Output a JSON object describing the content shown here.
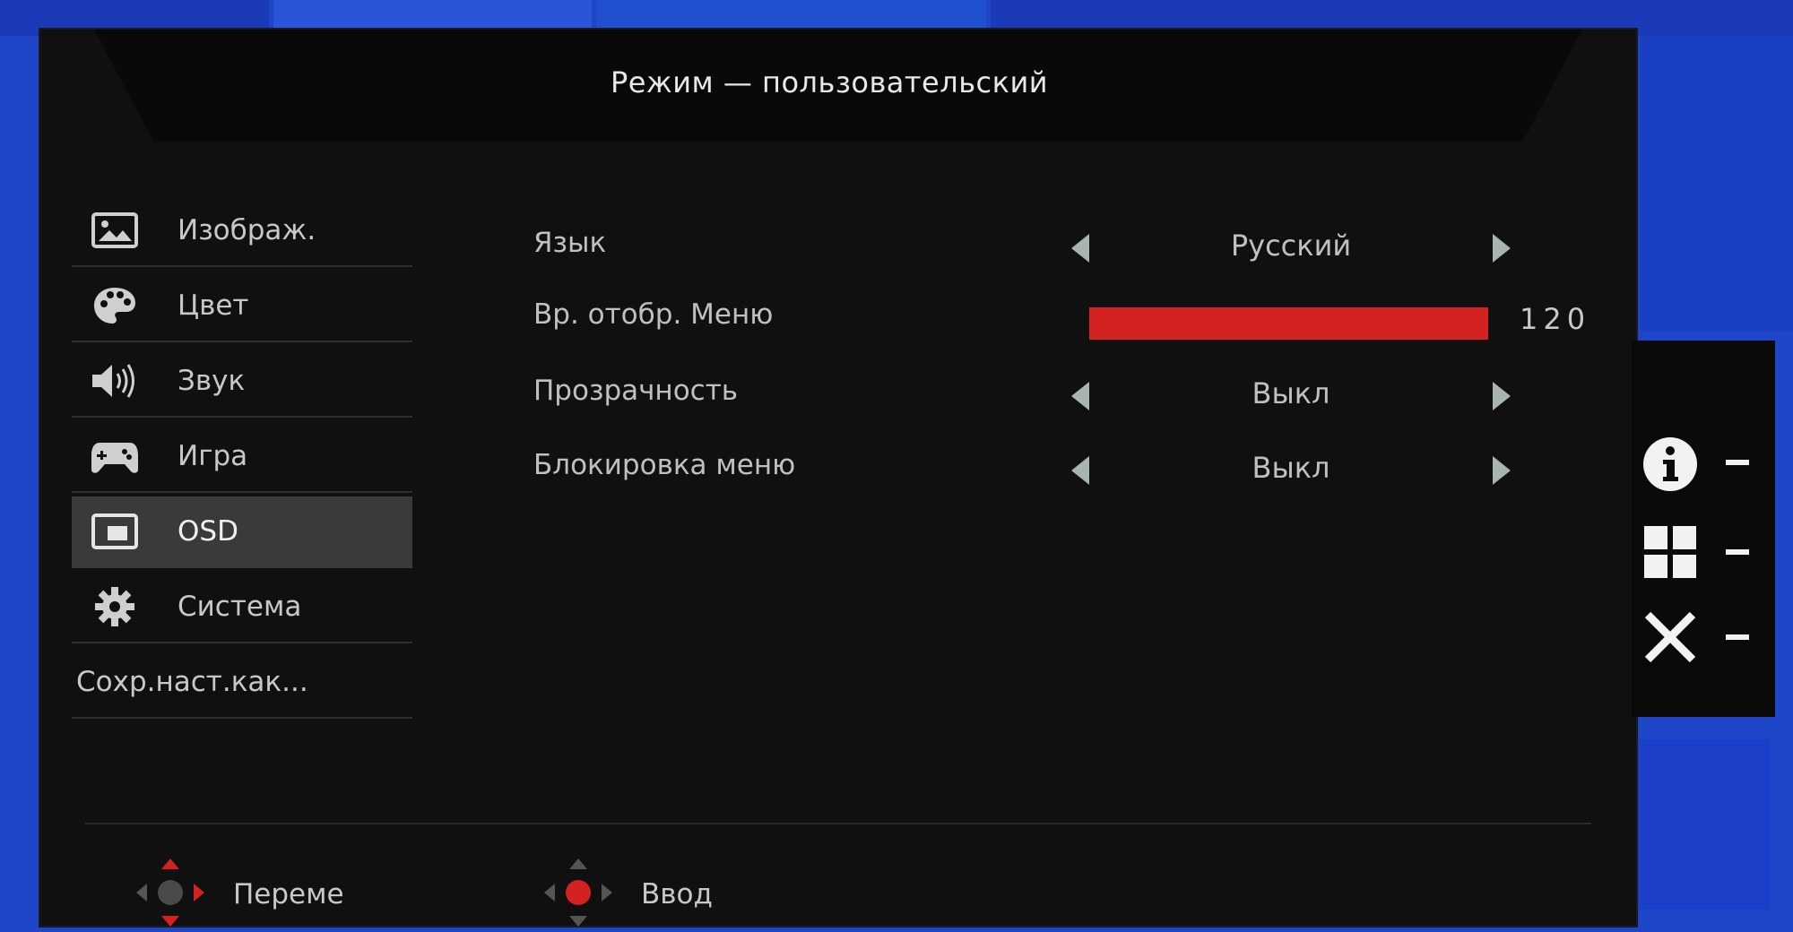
{
  "title": "Режим — пользовательский",
  "sidebar": {
    "items": [
      {
        "label": "Изображ.",
        "icon": "picture-icon"
      },
      {
        "label": "Цвет",
        "icon": "palette-icon"
      },
      {
        "label": "Звук",
        "icon": "speaker-icon"
      },
      {
        "label": "Игра",
        "icon": "gamepad-icon"
      },
      {
        "label": "OSD",
        "icon": "osd-icon"
      },
      {
        "label": "Система",
        "icon": "gear-icon"
      },
      {
        "label": "Сохр.наст.как..."
      }
    ],
    "active": "OSD"
  },
  "settings": {
    "language": {
      "label": "Язык",
      "value": "Русский"
    },
    "menu_time": {
      "label": "Вр. отобр. Меню",
      "value": "120",
      "progress": 1.0
    },
    "transparency": {
      "label": "Прозрачность",
      "value": "Выкл"
    },
    "menu_lock": {
      "label": "Блокировка меню",
      "value": "Выкл"
    }
  },
  "hotkeys": [
    "info-icon",
    "grid-icon",
    "close-icon"
  ],
  "footer": {
    "move_label": "Переме",
    "enter_label": "Ввод"
  },
  "colors": {
    "accent": "#d42121",
    "background": "#101010",
    "desktop": "#1f45c8"
  }
}
